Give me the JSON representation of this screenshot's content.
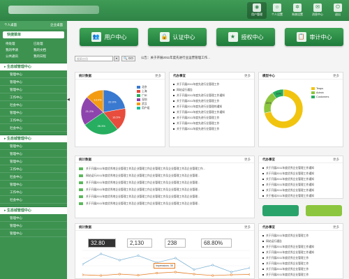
{
  "header": {
    "buttons": [
      {
        "label": "用户管理",
        "icon": "user-icon",
        "glyph": "◉"
      },
      {
        "label": "个人设置",
        "icon": "person-settings-icon",
        "glyph": "☺"
      },
      {
        "label": "系统设置",
        "icon": "gear-icon",
        "glyph": "✲"
      },
      {
        "label": "消息中心",
        "icon": "mail-icon",
        "glyph": "✉"
      },
      {
        "label": "退出",
        "icon": "power-icon",
        "glyph": "⏻"
      }
    ]
  },
  "sidebar": {
    "user_label": "个人桌面",
    "enterprise_label": "企业桌面",
    "fast_menu_title": "快捷菜单",
    "quick_links": [
      "待处理",
      "已处理",
      "我的申请",
      "我的文档",
      "公共通讯",
      "我的日程"
    ],
    "groups": [
      {
        "title": "生态城管理中心",
        "items": [
          "管理中心",
          "管理中心",
          "管理中心",
          "工作中心",
          "社会中心",
          "管理中心",
          "工作中心",
          "社会中心"
        ]
      },
      {
        "title": "生态城管理中心",
        "items": [
          "管理中心",
          "管理中心",
          "管理中心",
          "工作中心",
          "社会中心",
          "管理中心",
          "工作中心",
          "社会中心"
        ]
      },
      {
        "title": "生态城管理中心",
        "items": [
          "管理中心",
          "管理中心",
          "管理中心"
        ]
      }
    ]
  },
  "topnav": [
    {
      "label": "用户中心",
      "icon": "users-icon",
      "glyph": "👥"
    },
    {
      "label": "认证中心",
      "icon": "lock-icon",
      "glyph": "🔒"
    },
    {
      "label": "授权中心",
      "icon": "shield-icon",
      "glyph": "★"
    },
    {
      "label": "审计中心",
      "icon": "audit-icon",
      "glyph": "📋"
    }
  ],
  "search": {
    "placeholder": "搜索应用",
    "go_label": "GO",
    "notice": "公告：关于开展2011年度先进行业运营管理工作..."
  },
  "panels": {
    "stats": {
      "title": "统计数据",
      "more": "更多"
    },
    "todo": {
      "title": "代办事宜",
      "more": "更多"
    },
    "model": {
      "title": "模型中心",
      "more": "更多"
    },
    "news": {
      "title": "统计数据",
      "more": "更多"
    },
    "todo2": {
      "title": "代办事宜",
      "more": "更多"
    },
    "bottom_stats": {
      "title": "统计数据",
      "more": "更多"
    },
    "bottom_todo": {
      "title": "代办事宜",
      "more": "更多"
    }
  },
  "todo_items": [
    "关于开展2011年度先进行业管理工作",
    "网站运行通告",
    "关于开展2011年度先进行业管理工作通知",
    "关于开展2011年度先进行业管理工作",
    "关于开展2011年度先进行业管理的通知",
    "关于开展2011年度先进行业管理工作通知",
    "关于开展2011年度先进行业管理工作",
    "关于开展2011年度先进行业管理工作",
    "关于开展2011年度先进行业管理工作"
  ],
  "news_items": [
    "关于开展2011年度优秀地企业管理工作及企业管理工作企业管理工作及企业管理工作及企业管理工作...",
    "网站运行2011年度优秀地企业管理工作及企业管理工作企业管理工作及企业管理工作及企业管理...",
    "关于开展2011年度优秀地企业管理工作及企业管理工作企业管理工作及企业管理工作及企业管理...",
    "关于开展2011年度优秀地企业管理工作及企业管理工作企业管理工作及企业管理工作及企业管理...",
    "关于开展2011年度优秀地企业管理工作及企业管理工作企业管理工作及企业管理工作及企业管理...",
    "关于开展2011年度优秀地企业管理工作及企业管理工作企业管理工作及企业管理工作及企业管理..."
  ],
  "todo2_items": [
    "关于开展2011年度优秀企业管理工作通知",
    "关于开展2011年度优秀企业管理工作通知",
    "关于开展2011年度优秀企业管理工作通知",
    "关于开展2011年度优秀企业管理工作通知",
    "关于开展2011年度优秀企业管理工作通知",
    "关于推动2011年度优秀企业管理工作通知"
  ],
  "bottom_todo_items": [
    "关于开展2011年度优秀企业管理工作",
    "网站运行通告",
    "关于开展2011年度优秀企业管理工作通知",
    "关于开展2011年度优秀企业管理工作通知",
    "关于开展2011年度优秀企业管理工作",
    "关于开展2011年度优秀企业管理工作",
    "关于开展2011年度优秀企业管理工作",
    "关于开展2011年度优秀企业管理工作",
    "关于开展2011年度优秀企业管理工作"
  ],
  "kpis": [
    "32.80",
    "2,130",
    "238",
    "68.80%"
  ],
  "pie_legend": [
    "北京",
    "上海",
    "广州",
    "深圳",
    "武汉",
    "用户组"
  ],
  "donut_legend": [
    "Teaps",
    "Admin",
    "Customers"
  ],
  "tooltip": "Impressions: 35",
  "colors": {
    "accent": "#2f8446",
    "sidebar": "#3d9250"
  },
  "chart_data": [
    {
      "type": "pie",
      "values": [
        22.0,
        16.5,
        26.3,
        21.2,
        13.0
      ],
      "labels": [
        "22.0%",
        "16.5%",
        "26.3%",
        "21.2%",
        "13.0%"
      ],
      "colors": [
        "#3a79d0",
        "#e74c3c",
        "#27ae60",
        "#8e44ad",
        "#f39c12"
      ]
    },
    {
      "type": "pie",
      "values": [
        75,
        20,
        10
      ],
      "labels": [
        "",
        "20%",
        "10%"
      ],
      "colors": [
        "#f1c40f",
        "#8cc63f",
        "#27ae60"
      ]
    },
    {
      "type": "line",
      "series": [
        {
          "values": [
            40,
            70,
            52,
            65,
            45,
            58,
            25,
            38,
            18,
            30
          ]
        },
        {
          "values": [
            10,
            8,
            12,
            9,
            15,
            18,
            12,
            8,
            10,
            11
          ]
        }
      ]
    }
  ]
}
